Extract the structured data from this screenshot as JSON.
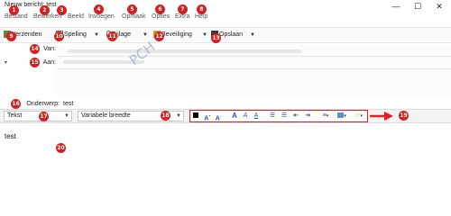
{
  "window": {
    "title": "Nieuw bericht: test",
    "controls": [
      "minimize-icon",
      "maximize-icon",
      "close-icon"
    ]
  },
  "menu": [
    "Bestand",
    "Bewerken",
    "Beeld",
    "Invoegen",
    "Opmaak",
    "Opties",
    "Extra",
    "Help"
  ],
  "toolbar": {
    "send_label": "Verzenden",
    "spelling_label": "Spelling",
    "attachment_label": "Bijlage",
    "security_label": "Beveiliging",
    "save_label": "Opslaan"
  },
  "header": {
    "from_label": "Van:",
    "to_label": "Aan:",
    "subject_label": "Onderwerp:",
    "subject_value": "test"
  },
  "format": {
    "style_value": "Tekst",
    "font_value": "Variabele breedte",
    "tools": [
      "text-color-icon",
      "font-larger-icon",
      "font-smaller-icon",
      "bold-icon",
      "italic-icon",
      "underline-icon",
      "bullet-list-icon",
      "numbered-list-icon",
      "outdent-icon",
      "indent-icon",
      "align-icon",
      "insert-icon",
      "emoji-icon"
    ]
  },
  "body": {
    "text": "test"
  },
  "watermark": "PCH",
  "badges": [
    "1",
    "2",
    "3",
    "4",
    "5",
    "6",
    "7",
    "8",
    "9",
    "10",
    "11",
    "12",
    "13",
    "14",
    "15",
    "16",
    "17",
    "18",
    "19",
    "20"
  ],
  "colors": {
    "badge": "#d42020",
    "highlight": "#e02020",
    "accent": "#2a56b0"
  }
}
